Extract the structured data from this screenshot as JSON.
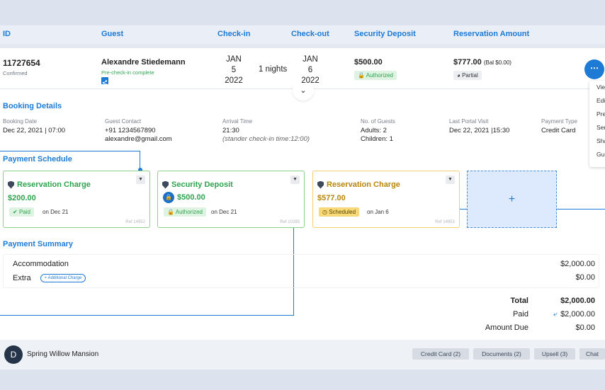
{
  "header": {
    "id": "ID",
    "guest": "Guest",
    "checkin": "Check-in",
    "checkout": "Check-out",
    "deposit": "Security Deposit",
    "amount": "Reservation Amount"
  },
  "reservation": {
    "id": "11727654",
    "status": "Confirmed",
    "guest_name": "Alexandre Stiedemann",
    "guest_status": "Pre-check-in complete",
    "checkin_month": "JAN",
    "checkin_day": "5",
    "checkin_year": "2022",
    "nights": "1 nights",
    "checkout_month": "JAN",
    "checkout_day": "6",
    "checkout_year": "2022",
    "deposit_amount": "$500.00",
    "deposit_status": "Authorized",
    "res_amount": "$777.00",
    "res_balance": "(Bal $0.00)",
    "res_status": "Partial"
  },
  "menu": [
    "Vie",
    "Edi",
    "Pre",
    "Sen",
    "Sha",
    "Gu"
  ],
  "booking": {
    "title": "Booking Details",
    "booking_date_label": "Booking Date",
    "booking_date": "Dec 22, 2021 | 07:00",
    "contact_label": "Guest Contact",
    "phone": "+91 1234567890",
    "email": "alexandre@gmail.com",
    "arrival_label": "Arrival Time",
    "arrival": "21:30",
    "arrival_note": "(stander check-in time:12:00)",
    "guests_label": "No. of Guests",
    "adults": "Adults: 2",
    "children": "Children: 1",
    "portal_label": "Last Portal Visit",
    "portal": "Dec 22, 2021 |15:30",
    "payment_label": "Payment Type",
    "payment": "Credit Card"
  },
  "schedule": {
    "title": "Payment Schedule",
    "cards": [
      {
        "title": "Reservation Charge",
        "amount": "$200.00",
        "status": "Paid",
        "on": "on Dec 21",
        "ref": "Ref 14952"
      },
      {
        "title": "Security Deposit",
        "amount": "$500.00",
        "status": "Authorized",
        "on": "on Dec 21",
        "ref": "Ref 10285"
      },
      {
        "title": "Reservation Charge",
        "amount": "$577.00",
        "status": "Scheduled",
        "on": "on Jan 6",
        "ref": "Ref 14953"
      }
    ],
    "add": "+"
  },
  "summary": {
    "title": "Payment Summary",
    "accommodation_label": "Accommodation",
    "accommodation": "$2,000.00",
    "extra_label": "Extra",
    "extra_button": "+ Additional Charge",
    "extra": "$0.00",
    "total_label": "Total",
    "total": "$2,000.00",
    "paid_label": "Paid",
    "paid": "$2,000.00",
    "due_label": "Amount Due",
    "due": "$0.00"
  },
  "footer": {
    "avatar": "D",
    "property": "Spring Willow Mansion",
    "buttons": [
      "Credit Card (2)",
      "Documents (2)",
      "Upsell (3)",
      "Chat"
    ]
  },
  "colors": {
    "accent": "#1d7bd6",
    "success": "#2ea44f",
    "warning": "#b8860b"
  }
}
